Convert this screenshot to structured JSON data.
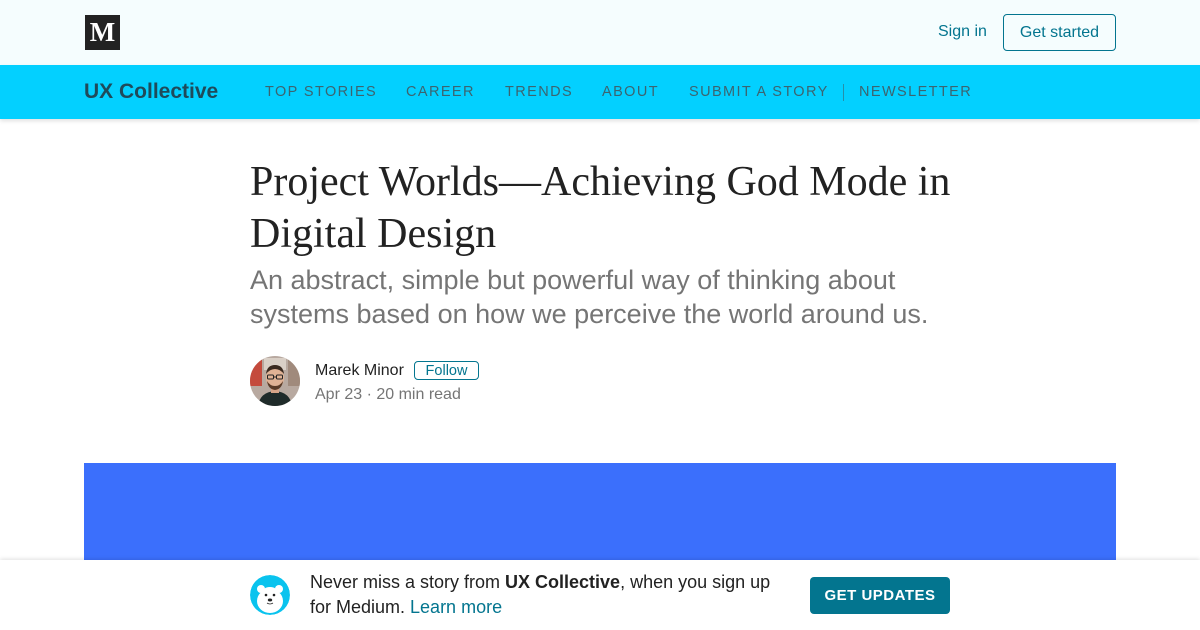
{
  "header": {
    "logo_letter": "M",
    "signin_label": "Sign in",
    "get_started_label": "Get started"
  },
  "nav": {
    "publication": "UX Collective",
    "items": [
      "TOP STORIES",
      "CAREER",
      "TRENDS",
      "ABOUT",
      "SUBMIT A STORY",
      "NEWSLETTER"
    ]
  },
  "article": {
    "title": "Project Worlds—Achieving God Mode in Digital Design",
    "subtitle": "An abstract, simple but powerful way of thinking about systems based on how we perceive the world around us.",
    "author": "Marek Minor",
    "follow_label": "Follow",
    "meta": "Apr 23 · 20 min read"
  },
  "banner": {
    "text_before": "Never miss a story from ",
    "publication": "UX Collective",
    "text_after": ", when you sign up for Medium. ",
    "learn_more": "Learn more",
    "button_label": "GET UPDATES"
  },
  "colors": {
    "accent": "#03758f",
    "nav_bg": "#03d0ff",
    "hero_bg": "#3b6ffc",
    "topbar_bg": "#f5fdfe"
  },
  "icons": {
    "logo": "medium-logo-icon",
    "avatar": "author-avatar",
    "banner": "polar-bear-icon"
  }
}
